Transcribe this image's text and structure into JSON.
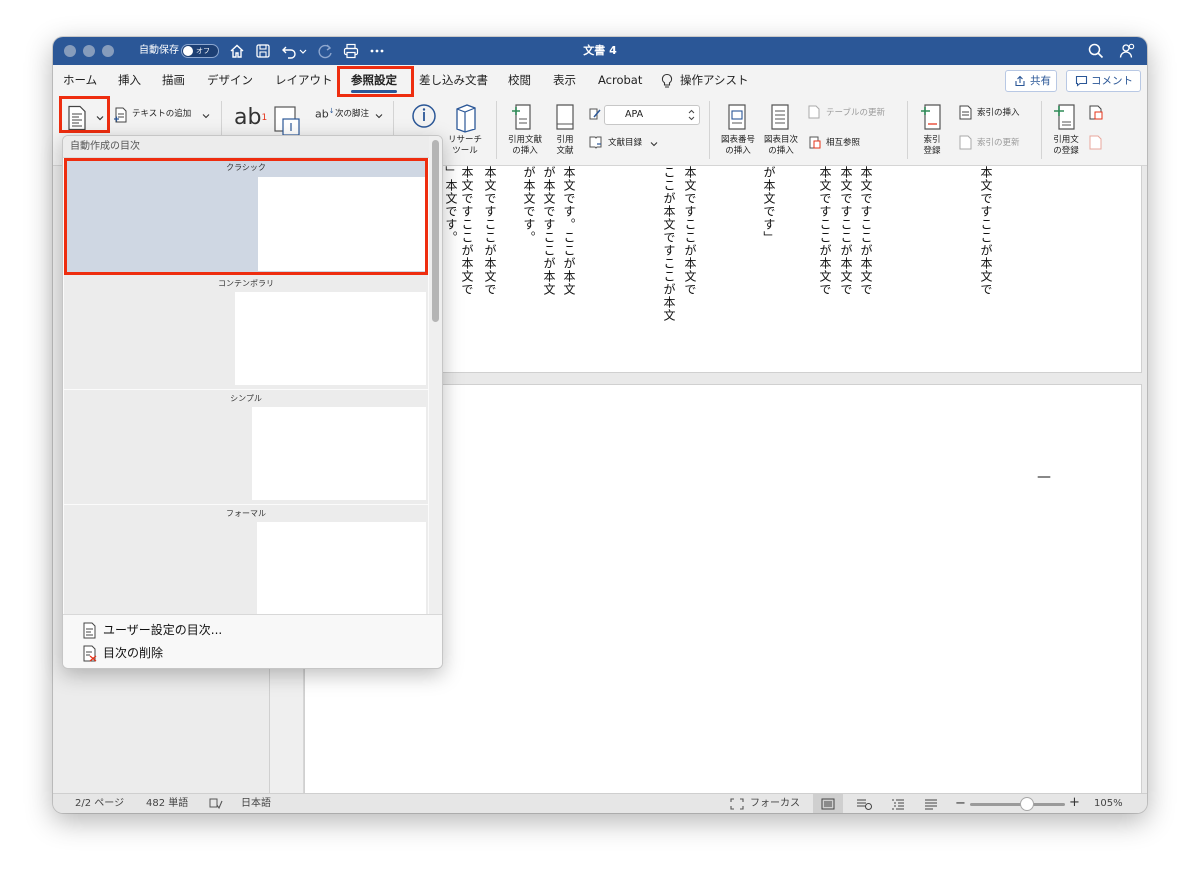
{
  "window": {
    "autosave_label": "自動保存",
    "autosave_state": "オフ",
    "doc_title": "文書 4"
  },
  "tabs": [
    "ホーム",
    "挿入",
    "描画",
    "デザイン",
    "レイアウト",
    "参照設定",
    "差し込み文書",
    "校閲",
    "表示",
    "Acrobat",
    "操作アシスト"
  ],
  "active_tab": "参照設定",
  "header_buttons": {
    "share": "共有",
    "comment": "コメント"
  },
  "ribbon": {
    "add_text": "テキストの追加",
    "next_footnote": "次の脚注",
    "research_tool": "リサーチ\nツール",
    "insert_citation": "引用文献\nの挿入",
    "sources": "引用\n文献",
    "style_value": "APA",
    "bibliography": "文献目録",
    "insert_caption": "図表番号\nの挿入",
    "insert_table_of_figures": "図表目次\nの挿入",
    "update_table": "テーブルの更新",
    "cross_reference": "相互参照",
    "mark_entry": "索引\n登録",
    "insert_index": "索引の挿入",
    "update_index": "索引の更新",
    "mark_citation": "引用文\nの登録"
  },
  "toc_dropdown": {
    "header": "自動作成の目次",
    "styles": [
      "クラシック",
      "コンテンポラリ",
      "シンプル",
      "フォーマル"
    ],
    "custom_toc": "ユーザー設定の目次...",
    "remove_toc": "目次の削除"
  },
  "document": {
    "columns": [
      "」本文です。",
      "本文ですここが本文で",
      "本文ですここが本文で",
      "が本文です。",
      "が本文ですここが本文",
      "本文です。ここが本文",
      "ここが本文ですここが本文",
      "本文ですここが本文で",
      "が本文です」",
      "本文ですここが本文で",
      "本文ですここが本文で",
      "本文ですここが本文で",
      "本文ですここが本文で"
    ],
    "page2_mark": "—"
  },
  "status": {
    "page": "2/2 ページ",
    "words": "482 単語",
    "language": "日本語",
    "focus": "フォーカス",
    "zoom": "105%",
    "zoom_level": 0.6
  }
}
